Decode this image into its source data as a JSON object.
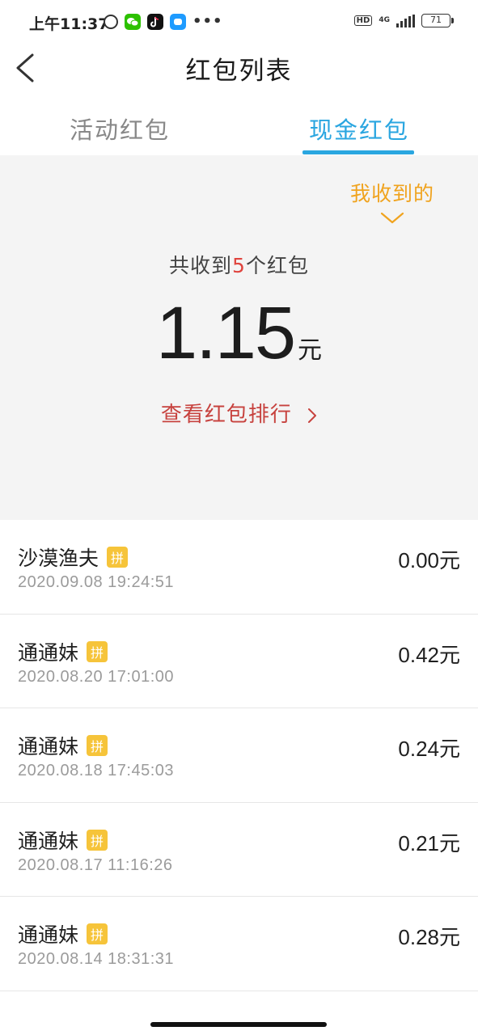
{
  "status_bar": {
    "time": "上午11:37",
    "network": "4G",
    "hd": "HD",
    "battery": "71",
    "more": "•••"
  },
  "header": {
    "title": "红包列表"
  },
  "tabs": [
    {
      "label": "活动红包",
      "active": false
    },
    {
      "label": "现金红包",
      "active": true
    }
  ],
  "summary": {
    "filter_label": "我收到的",
    "received_prefix": "共收到",
    "received_count": "5",
    "received_suffix": "个红包",
    "total_amount": "1.15",
    "unit": "元",
    "rank_link": "查看红包排行"
  },
  "records": [
    {
      "name": "沙漠渔夫",
      "badge": "拼",
      "time": "2020.09.08 19:24:51",
      "amount": "0.00元"
    },
    {
      "name": "通通妹",
      "badge": "拼",
      "time": "2020.08.20 17:01:00",
      "amount": "0.42元"
    },
    {
      "name": "通通妹",
      "badge": "拼",
      "time": "2020.08.18 17:45:03",
      "amount": "0.24元"
    },
    {
      "name": "通通妹",
      "badge": "拼",
      "time": "2020.08.17 11:16:26",
      "amount": "0.21元"
    },
    {
      "name": "通通妹",
      "badge": "拼",
      "time": "2020.08.14 18:31:31",
      "amount": "0.28元"
    }
  ],
  "colors": {
    "accent_blue": "#2aa6e0",
    "filter_orange": "#f0a31e",
    "link_red": "#c7423e",
    "count_red": "#e0443e",
    "badge_yellow": "#f6c43a"
  }
}
